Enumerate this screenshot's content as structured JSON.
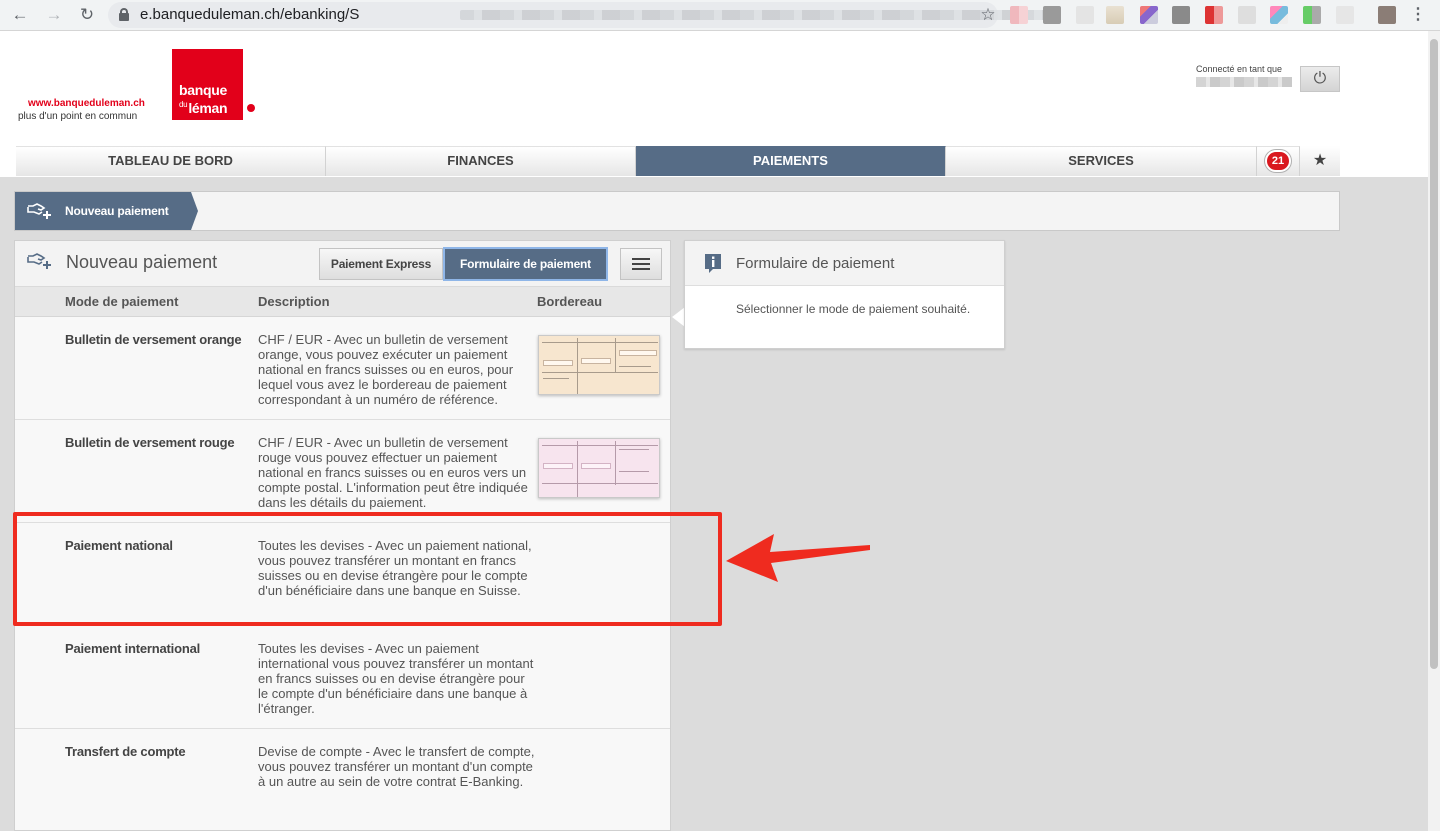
{
  "browser": {
    "url": "e.banqueduleman.ch/ebanking/S",
    "back_glyph": "←",
    "forward_glyph": "→",
    "reload_glyph": "↻",
    "bookmark_glyph": "☆",
    "menu_glyph": "⋮"
  },
  "header": {
    "site_url": "www.banqueduleman.ch",
    "tagline": "plus d'un point en commun",
    "logo_line1": "banque",
    "logo_du": "du",
    "logo_line2": "léman",
    "connected_label": "Connecté en tant que",
    "power_glyph": "⏻"
  },
  "nav": {
    "tabs": [
      {
        "label": "TABLEAU DE BORD",
        "active": false
      },
      {
        "label": "FINANCES",
        "active": false
      },
      {
        "label": "PAIEMENTS",
        "active": true
      },
      {
        "label": "SERVICES",
        "active": false
      }
    ],
    "notifications_count": "21",
    "favorites_glyph": "★"
  },
  "breadcrumb": {
    "label": "Nouveau paiement"
  },
  "panel": {
    "title": "Nouveau paiement",
    "btn_express": "Paiement Express",
    "btn_form": "Formulaire de paiement",
    "columns": {
      "mode": "Mode de paiement",
      "description": "Description",
      "slip": "Bordereau"
    },
    "rows": [
      {
        "mode": "Bulletin de versement orange",
        "description": "CHF / EUR - Avec un bulletin de versement orange, vous pouvez exécuter un paiement national en francs suisses ou en euros, pour lequel vous avez le bordereau de paiement correspondant à un numéro de référence.",
        "slip": "orange"
      },
      {
        "mode": "Bulletin de versement rouge",
        "description": "CHF / EUR - Avec un bulletin de versement rouge vous pouvez effectuer un paiement national en francs suisses ou en euros vers un compte postal. L'information peut être indiquée dans les détails du paiement.",
        "slip": "pink"
      },
      {
        "mode": "Paiement national",
        "description": "Toutes les devises - Avec un paiement national, vous pouvez transférer un montant en francs suisses ou en devise étrangère pour le compte d'un bénéficiaire dans une banque en Suisse.",
        "slip": "none"
      },
      {
        "mode": "Paiement international",
        "description": "Toutes les devises - Avec un paiement international vous pouvez transférer un montant en francs suisses ou en devise étrangère pour le compte d'un bénéficiaire dans une banque à l'étranger.",
        "slip": "none"
      },
      {
        "mode": "Transfert de compte",
        "description": "Devise de compte - Avec le transfert de compte, vous pouvez transférer un montant d'un compte à un autre au sein de votre contrat E-Banking.",
        "slip": "none"
      }
    ]
  },
  "info": {
    "title": "Formulaire de paiement",
    "text": "Sélectionner le mode de paiement souhaité."
  },
  "colors": {
    "brand_red": "#e2001a",
    "nav_active": "#566c86",
    "highlight": "#ef2b1f"
  }
}
